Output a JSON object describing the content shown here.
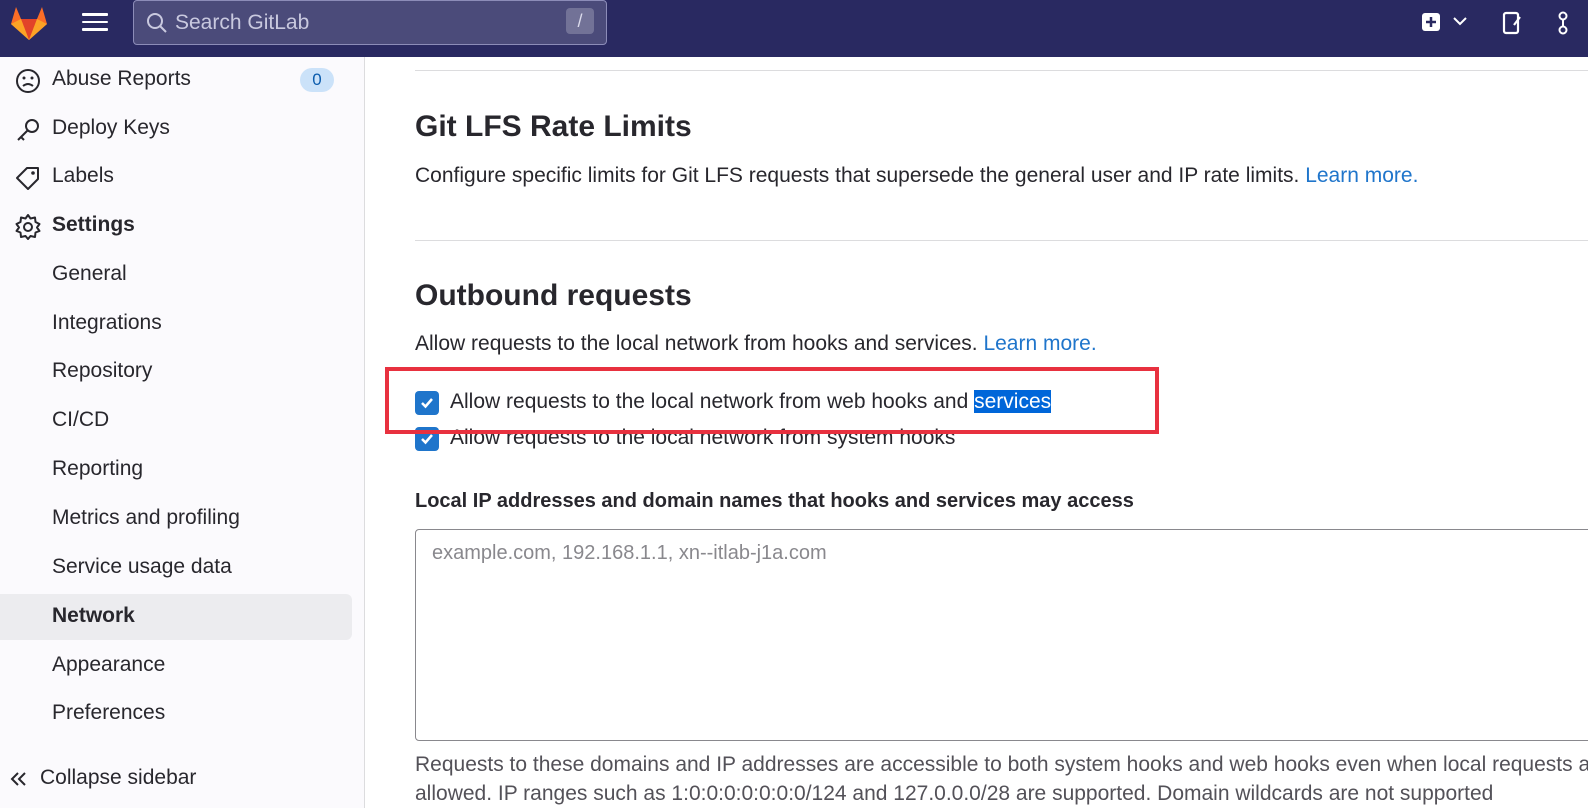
{
  "topbar": {
    "search_placeholder": "Search GitLab",
    "search_shortcut": "/"
  },
  "sidebar": {
    "items": [
      {
        "label": "Abuse Reports",
        "icon": "abuse-icon"
      },
      {
        "label": "Deploy Keys",
        "icon": "key-icon"
      },
      {
        "label": "Labels",
        "icon": "label-icon"
      },
      {
        "label": "Settings",
        "icon": "settings-icon"
      },
      {
        "label": "General"
      },
      {
        "label": "Integrations"
      },
      {
        "label": "Repository"
      },
      {
        "label": "CI/CD"
      },
      {
        "label": "Reporting"
      },
      {
        "label": "Metrics and profiling"
      },
      {
        "label": "Service usage data"
      },
      {
        "label": "Network"
      },
      {
        "label": "Appearance"
      },
      {
        "label": "Preferences"
      }
    ],
    "abuse_count": "0",
    "collapse_label": "Collapse sidebar"
  },
  "main": {
    "lfs": {
      "title": "Git LFS Rate Limits",
      "description": "Configure specific limits for Git LFS requests that supersede the general user and IP rate limits.",
      "learn_more": "Learn more."
    },
    "outbound": {
      "title": "Outbound requests",
      "description": "Allow requests to the local network from hooks and services.",
      "learn_more": "Learn more.",
      "checkbox1_label_prefix": "Allow requests to the local network from web hooks and ",
      "checkbox1_label_selected": "services",
      "checkbox1_checked": true,
      "checkbox2_label": "Allow requests to the local network from system hooks",
      "checkbox2_checked": true,
      "allowlist_label": "Local IP addresses and domain names that hooks and services may access",
      "allowlist_placeholder": "example.com, 192.168.1.1, xn--itlab-j1a.com",
      "help_text": "Requests to these domains and IP addresses are accessible to both system hooks and web hooks even when local requests are not allowed. IP ranges such as 1:0:0:0:0:0:0:0/124 and 127.0.0.0/28 are supported. Domain wildcards are not supported"
    }
  },
  "colors": {
    "topbar": "#292961",
    "accent": "#1f75cb",
    "highlight": "#e8313f"
  }
}
